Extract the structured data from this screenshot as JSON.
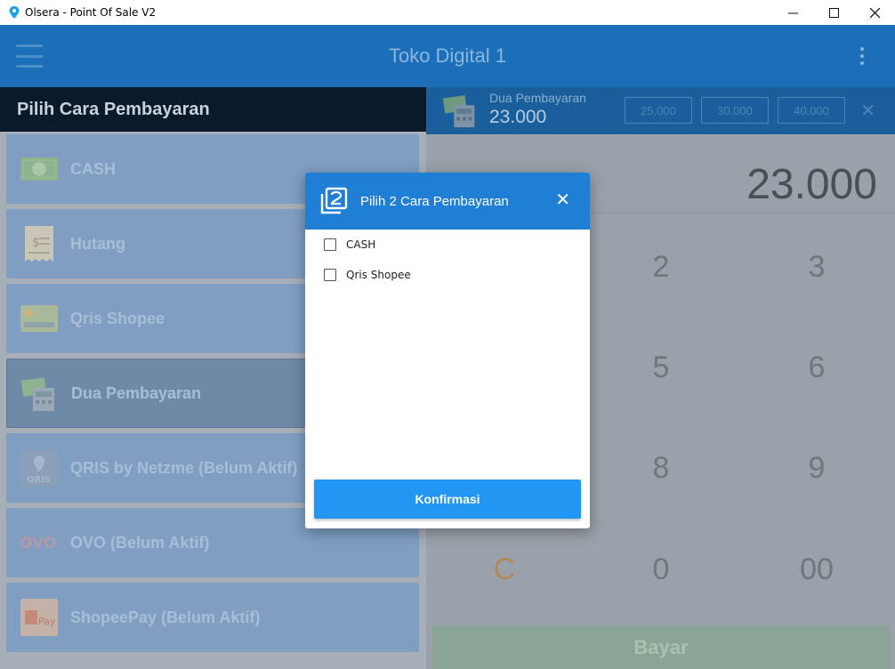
{
  "window": {
    "title": "Olsera - Point Of Sale V2",
    "minimize": "—",
    "maximize": "☐",
    "close": "✕"
  },
  "appbar": {
    "store_name": "Toko Digital 1"
  },
  "left_panel": {
    "header": "Pilih Cara Pembayaran",
    "methods": [
      {
        "label": "CASH",
        "icon": "cash-icon"
      },
      {
        "label": "Hutang",
        "icon": "receipt-icon"
      },
      {
        "label": "Qris Shopee",
        "icon": "qris-card-icon"
      },
      {
        "label": "Dua Pembayaran",
        "icon": "dual-payment-icon",
        "selected": true
      },
      {
        "label": "QRIS by Netzme (Belum Aktif)",
        "icon": "qris-netzme-icon"
      },
      {
        "label": "OVO (Belum Aktif)",
        "icon": "ovo-logo-icon"
      },
      {
        "label": "ShopeePay (Belum Aktif)",
        "icon": "shopeepay-logo-icon"
      }
    ]
  },
  "right_panel": {
    "payment_name": "Dua Pembayaran",
    "payment_amount": "23.000",
    "quick_amounts": [
      "25.000",
      "30.000",
      "40.000"
    ],
    "strip_close": "✕",
    "display_amount": "23.000",
    "keys": [
      "2",
      "3",
      "5",
      "6",
      "8",
      "9",
      "C",
      "0",
      "00"
    ],
    "pay_button": "Bayar"
  },
  "modal": {
    "title": "Pilih 2 Cara Pembayaran",
    "close": "✕",
    "options": [
      {
        "label": "CASH",
        "checked": false
      },
      {
        "label": "Qris Shopee",
        "checked": false
      }
    ],
    "confirm": "Konfirmasi"
  },
  "colors": {
    "primary": "#2196f3",
    "header_blue": "#1f7fd4",
    "appbar_blue": "#1b6fb8"
  }
}
